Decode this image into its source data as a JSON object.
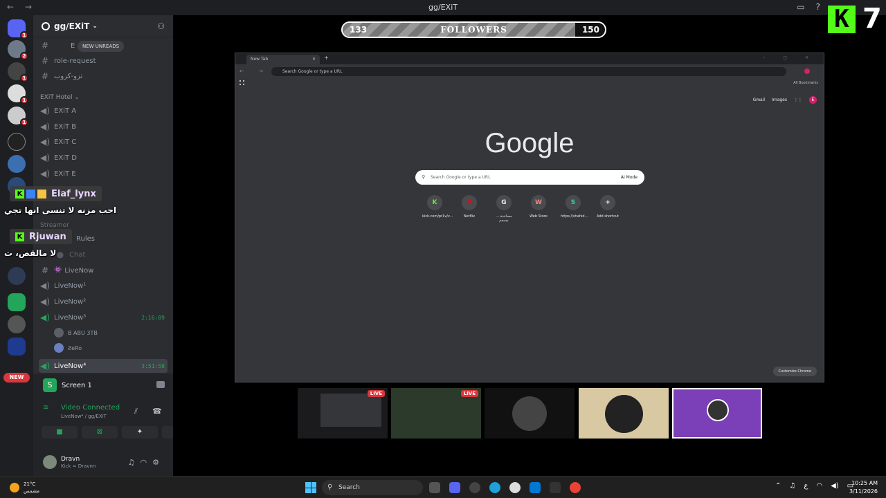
{
  "window": {
    "title": "gg/EXiT"
  },
  "sidebar": {
    "server_name": "gg/EXiT",
    "new_unreads": "NEW UNREADS",
    "pinned_channel": "E",
    "channels_top": [
      {
        "label": "role-request"
      },
      {
        "label": "تزو-كزوب"
      }
    ],
    "category_hotel": "EXiT Hotel",
    "voice_channels": [
      {
        "label": "EXiT A"
      },
      {
        "label": "EXiT B"
      },
      {
        "label": "EXiT C"
      },
      {
        "label": "EXiT D"
      },
      {
        "label": "EXiT E"
      }
    ],
    "category_streamer": "Streamer",
    "rules": "Rules",
    "chat": "Chat",
    "livenow_text": "LiveNow",
    "live_voice": [
      {
        "label": "LiveNow¹",
        "time": ""
      },
      {
        "label": "LiveNow²",
        "time": ""
      },
      {
        "label": "LiveNow³",
        "time": "2:16:09"
      }
    ],
    "voice_users": [
      "B ABU 3TB",
      "ƧeRo"
    ],
    "active_channel": {
      "label": "LiveNow⁴",
      "time": "3:51:58"
    },
    "new_badge": "NEW"
  },
  "chat_overlay": {
    "messages": [
      {
        "user": "Elaf_lynx",
        "text": "احب مزنه لا تنسى انها تجي"
      },
      {
        "user": "Rjuwan",
        "text": "لا مالقص، ت"
      }
    ]
  },
  "voice_panel": {
    "screen_label": "Screen 1",
    "status": "Video Connected",
    "location": "LiveNow⁴ / gg/EXiT",
    "user": {
      "name": "Dravn",
      "status": "Kick = Dravnn"
    }
  },
  "followers_bar": {
    "current": "133",
    "label": "FOLLOWERS",
    "goal": "150",
    "progress_fraction": 0.886
  },
  "kick_counter": "7",
  "chrome": {
    "tab_title": "New Tab",
    "omnibox_placeholder": "Search Google or type a URL",
    "all_bookmarks": "All Bookmarks",
    "gmail": "Gmail",
    "images": "Images",
    "profile_initial": "E",
    "logo": "Google",
    "search_placeholder": "Search Google or type a URL",
    "ai_mode": "AI Mode",
    "shortcuts": [
      {
        "label": "kick.com/pr1v/v...",
        "letter": "K",
        "color": "#53fc18"
      },
      {
        "label": "Netflix",
        "letter": "N",
        "color": "#e50914"
      },
      {
        "label": "... مساعدة مسجم",
        "letter": "G",
        "color": "#e8eaed"
      },
      {
        "label": "Web Store",
        "letter": "W",
        "color": "#f28b82"
      },
      {
        "label": "https://shahid...",
        "letter": "S",
        "color": "#34d399"
      },
      {
        "label": "Add shortcut",
        "letter": "+",
        "color": "#e8eaed"
      }
    ],
    "customize": "Customize Chrome"
  },
  "thumbnails": {
    "live_label": "LIVE"
  },
  "taskbar": {
    "temp": "21°C",
    "weather": "مشمس",
    "search": "Search",
    "lang": "ع",
    "time": "10:25 AM",
    "date": "3/11/2026"
  }
}
